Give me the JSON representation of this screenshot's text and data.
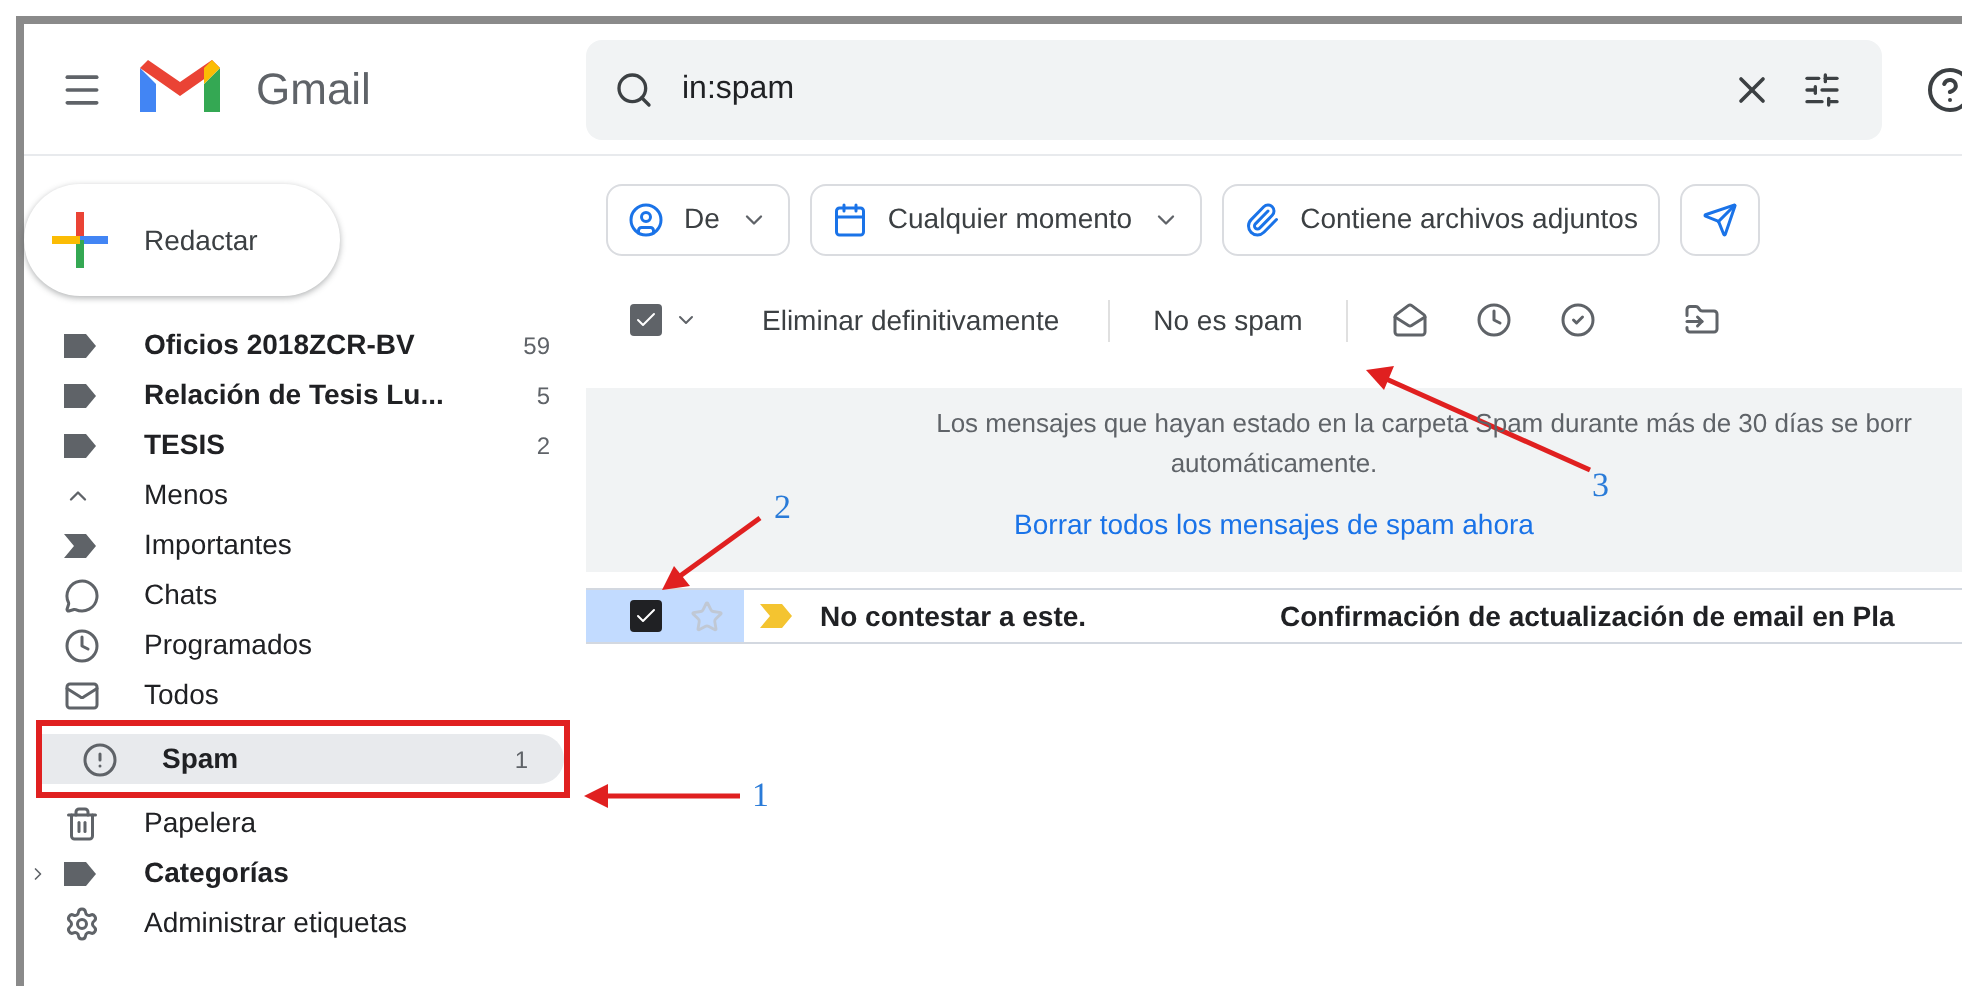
{
  "header": {
    "app_name": "Gmail",
    "search": {
      "value": "in:spam"
    }
  },
  "compose": {
    "label": "Redactar"
  },
  "sidebar": {
    "items": [
      {
        "kind": "label",
        "label": "Oficios 2018ZCR-BV",
        "count": "59",
        "bold": true,
        "selected": false,
        "boxed": false
      },
      {
        "kind": "label",
        "label": "Relación de Tesis Lu...",
        "count": "5",
        "bold": true,
        "selected": false,
        "boxed": false
      },
      {
        "kind": "label",
        "label": "TESIS",
        "count": "2",
        "bold": true,
        "selected": false,
        "boxed": false
      },
      {
        "kind": "less",
        "label": "Menos",
        "bold": false,
        "selected": false,
        "boxed": false
      },
      {
        "kind": "important",
        "label": "Importantes",
        "bold": false,
        "selected": false,
        "boxed": false
      },
      {
        "kind": "chat",
        "label": "Chats",
        "bold": false,
        "selected": false,
        "boxed": false
      },
      {
        "kind": "scheduled",
        "label": "Programados",
        "bold": false,
        "selected": false,
        "boxed": false
      },
      {
        "kind": "mail",
        "label": "Todos",
        "bold": false,
        "selected": false,
        "boxed": false
      },
      {
        "kind": "spam",
        "label": "Spam",
        "count": "1",
        "bold": true,
        "selected": true,
        "boxed": true
      },
      {
        "kind": "trash",
        "label": "Papelera",
        "bold": false,
        "selected": false,
        "boxed": false
      },
      {
        "kind": "category",
        "label": "Categorías",
        "bold": true,
        "selected": false,
        "boxed": false
      },
      {
        "kind": "settings",
        "label": "Administrar etiquetas",
        "bold": false,
        "selected": false,
        "boxed": false
      }
    ]
  },
  "filters": [
    {
      "kind": "from",
      "label": "De",
      "dropdown": true
    },
    {
      "kind": "time",
      "label": "Cualquier momento",
      "dropdown": true
    },
    {
      "kind": "attachment",
      "label": "Contiene archivos adjuntos",
      "dropdown": false
    },
    {
      "kind": "sent",
      "dropdown": false
    }
  ],
  "toolbar": {
    "select_all_checked": true,
    "delete_label": "Eliminar definitivamente",
    "not_spam_label": "No es spam"
  },
  "notice": {
    "line_1": "Los mensajes que hayan estado en la carpeta Spam durante más de 30 días se borr",
    "line_2": "automáticamente.",
    "link": "Borrar todos los mensajes de spam ahora"
  },
  "messages": [
    {
      "sender": "No contestar a este.",
      "subject": "Confirmación de actualización de email en Pla",
      "checked": true,
      "starred": false,
      "important": true
    }
  ],
  "annotations": [
    {
      "label": "1"
    },
    {
      "label": "2"
    },
    {
      "label": "3"
    }
  ]
}
